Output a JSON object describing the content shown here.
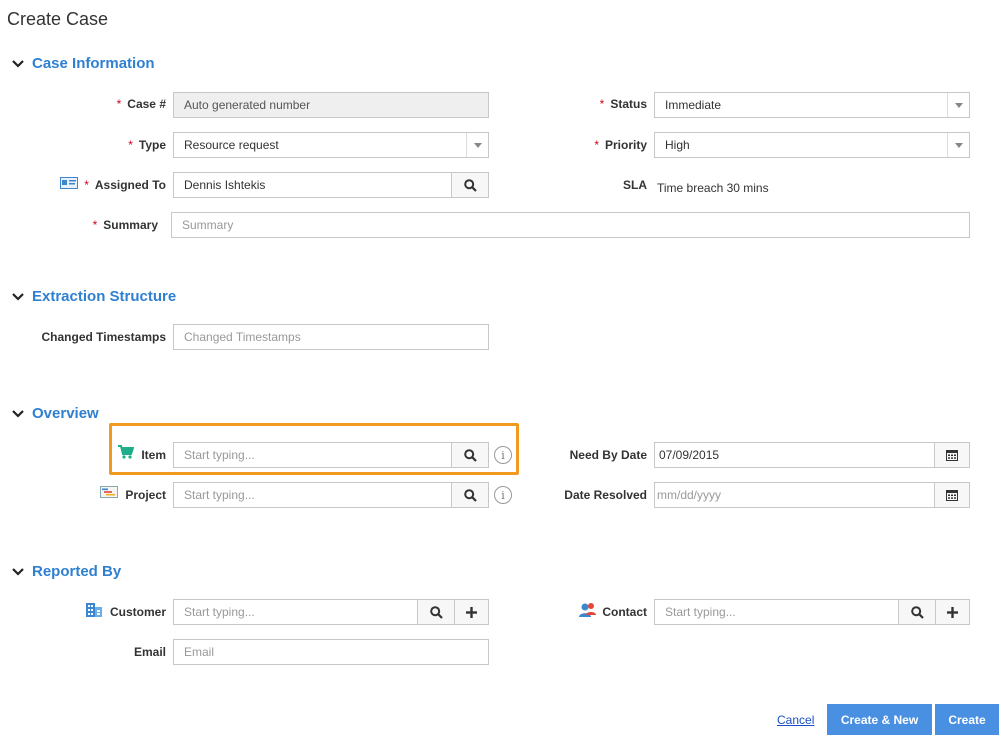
{
  "page": {
    "title": "Create Case"
  },
  "sections": {
    "case_information": "Case Information",
    "extraction_structure": "Extraction Structure",
    "overview": "Overview",
    "reported_by": "Reported By"
  },
  "case_info": {
    "case_no_label": "Case #",
    "case_no_value": "Auto generated number",
    "type_label": "Type",
    "type_value": "Resource request",
    "assigned_to_label": "Assigned To",
    "assigned_to_value": "Dennis Ishtekis",
    "summary_label": "Summary",
    "summary_placeholder": "Summary",
    "status_label": "Status",
    "status_value": "Immediate",
    "priority_label": "Priority",
    "priority_value": "High",
    "sla_label": "SLA",
    "sla_value": "Time breach 30 mins",
    "required_mark": "*"
  },
  "extraction": {
    "changed_timestamps_label": "Changed Timestamps",
    "changed_timestamps_placeholder": "Changed Timestamps"
  },
  "overview": {
    "item_label": "Item",
    "item_placeholder": "Start typing...",
    "project_label": "Project",
    "project_placeholder": "Start typing...",
    "need_by_label": "Need By Date",
    "need_by_value": "07/09/2015",
    "date_resolved_label": "Date Resolved",
    "date_resolved_placeholder": "mm/dd/yyyy",
    "info_glyph": "i"
  },
  "reported_by": {
    "customer_label": "Customer",
    "customer_placeholder": "Start typing...",
    "contact_label": "Contact",
    "contact_placeholder": "Start typing...",
    "email_label": "Email",
    "email_placeholder": "Email"
  },
  "footer": {
    "cancel_label": "Cancel",
    "create_new_label": "Create & New",
    "create_label": "Create"
  },
  "colors": {
    "accent": "#2f80d1",
    "primary_button": "#4a90e2",
    "highlight": "#f29a1f",
    "required": "#d0021b"
  },
  "icons": {
    "section_toggle": "chevron-down-icon",
    "search": "search-icon",
    "calendar": "calendar-icon",
    "add": "plus-icon",
    "info": "info-icon",
    "assigned_to": "id-card-icon",
    "item": "cart-icon",
    "project": "project-icon",
    "customer": "building-icon",
    "contact": "contacts-icon"
  }
}
